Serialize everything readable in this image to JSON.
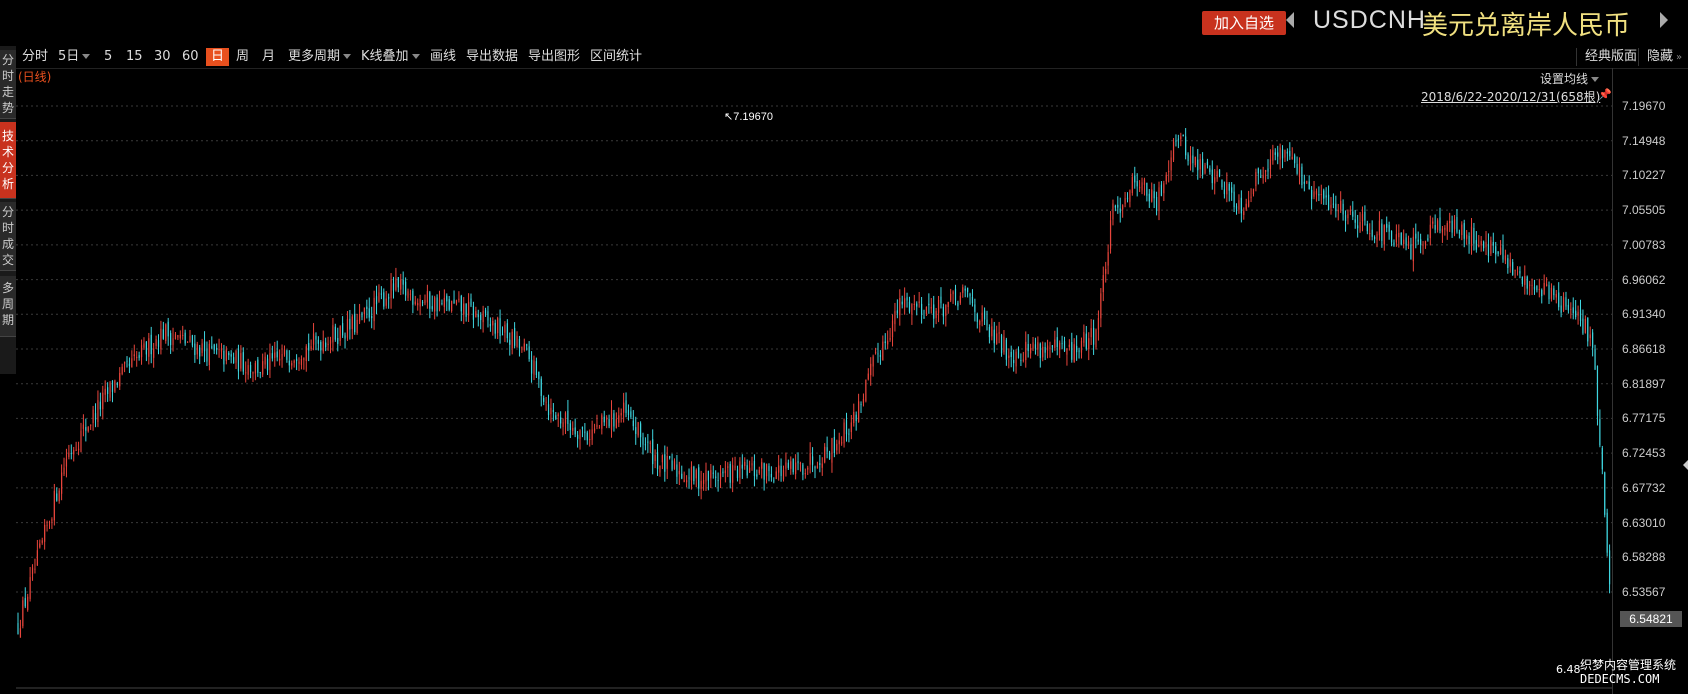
{
  "header": {
    "add_watchlist": "加入自选",
    "symbol_code": "USDCNH",
    "symbol_name": "美元兑离岸人民币"
  },
  "sidebar": {
    "tabs": [
      {
        "label": "分时走势",
        "active": false
      },
      {
        "label": "技术分析",
        "active": true
      },
      {
        "label": "分时成交",
        "active": false
      },
      {
        "label": "多周期",
        "active": false
      }
    ]
  },
  "toolbar": {
    "items": [
      "分时",
      "5日",
      "5",
      "15",
      "30",
      "60",
      "日",
      "周",
      "月",
      "更多周期",
      "K线叠加",
      "画线",
      "导出数据",
      "导出图形",
      "区间统计"
    ],
    "active": "日",
    "classic_layout": "经典版面",
    "hide": "隐藏"
  },
  "chart_info": {
    "period_label": "(日线)",
    "ma_setting": "设置均线",
    "range": "2018/6/22-2020/12/31(658根)",
    "high_label": "7.19670",
    "low_label": "6.48",
    "current_price": "6.54821"
  },
  "watermark": {
    "line1": "织梦内容管理系统",
    "line2": "DEDECMS.COM"
  },
  "colors": {
    "up": "#e8453c",
    "down": "#3fd6e0",
    "accent": "#c8321e"
  },
  "chart_data": {
    "type": "candlestick",
    "title": "",
    "xlabel": "",
    "ylabel": "",
    "period": "daily",
    "date_range": [
      "2018-06-22",
      "2020-12-31"
    ],
    "bar_count": 658,
    "yticks": [
      "7.19670",
      "7.14948",
      "7.10227",
      "7.05505",
      "7.00783",
      "6.96062",
      "6.91340",
      "6.86618",
      "6.81897",
      "6.77175",
      "6.72453",
      "6.67732",
      "6.63010",
      "6.58288",
      "6.53567"
    ],
    "ylim": [
      6.48,
      7.2
    ],
    "high": 7.1967,
    "low": 6.48,
    "last": 6.54821,
    "grid": true,
    "approx_close_path": [
      [
        0,
        6.49
      ],
      [
        10,
        6.6
      ],
      [
        20,
        6.72
      ],
      [
        40,
        6.82
      ],
      [
        60,
        6.89
      ],
      [
        80,
        6.86
      ],
      [
        100,
        6.84
      ],
      [
        120,
        6.87
      ],
      [
        140,
        6.9
      ],
      [
        155,
        6.95
      ],
      [
        170,
        6.93
      ],
      [
        185,
        6.92
      ],
      [
        200,
        6.89
      ],
      [
        210,
        6.86
      ],
      [
        220,
        6.78
      ],
      [
        235,
        6.75
      ],
      [
        250,
        6.78
      ],
      [
        265,
        6.71
      ],
      [
        280,
        6.69
      ],
      [
        300,
        6.7
      ],
      [
        320,
        6.7
      ],
      [
        335,
        6.73
      ],
      [
        345,
        6.77
      ],
      [
        355,
        6.86
      ],
      [
        365,
        6.93
      ],
      [
        380,
        6.92
      ],
      [
        392,
        6.94
      ],
      [
        400,
        6.89
      ],
      [
        410,
        6.86
      ],
      [
        420,
        6.87
      ],
      [
        435,
        6.86
      ],
      [
        445,
        6.89
      ],
      [
        452,
        7.05
      ],
      [
        462,
        7.1
      ],
      [
        470,
        7.06
      ],
      [
        478,
        7.16
      ],
      [
        485,
        7.12
      ],
      [
        495,
        7.1
      ],
      [
        505,
        7.06
      ],
      [
        515,
        7.12
      ],
      [
        525,
        7.14
      ],
      [
        532,
        7.08
      ],
      [
        545,
        7.06
      ],
      [
        560,
        7.03
      ],
      [
        575,
        7.0
      ],
      [
        585,
        7.04
      ],
      [
        600,
        7.02
      ],
      [
        610,
        7.0
      ],
      [
        620,
        6.96
      ],
      [
        630,
        6.95
      ],
      [
        640,
        6.92
      ],
      [
        650,
        6.88
      ]
    ]
  }
}
